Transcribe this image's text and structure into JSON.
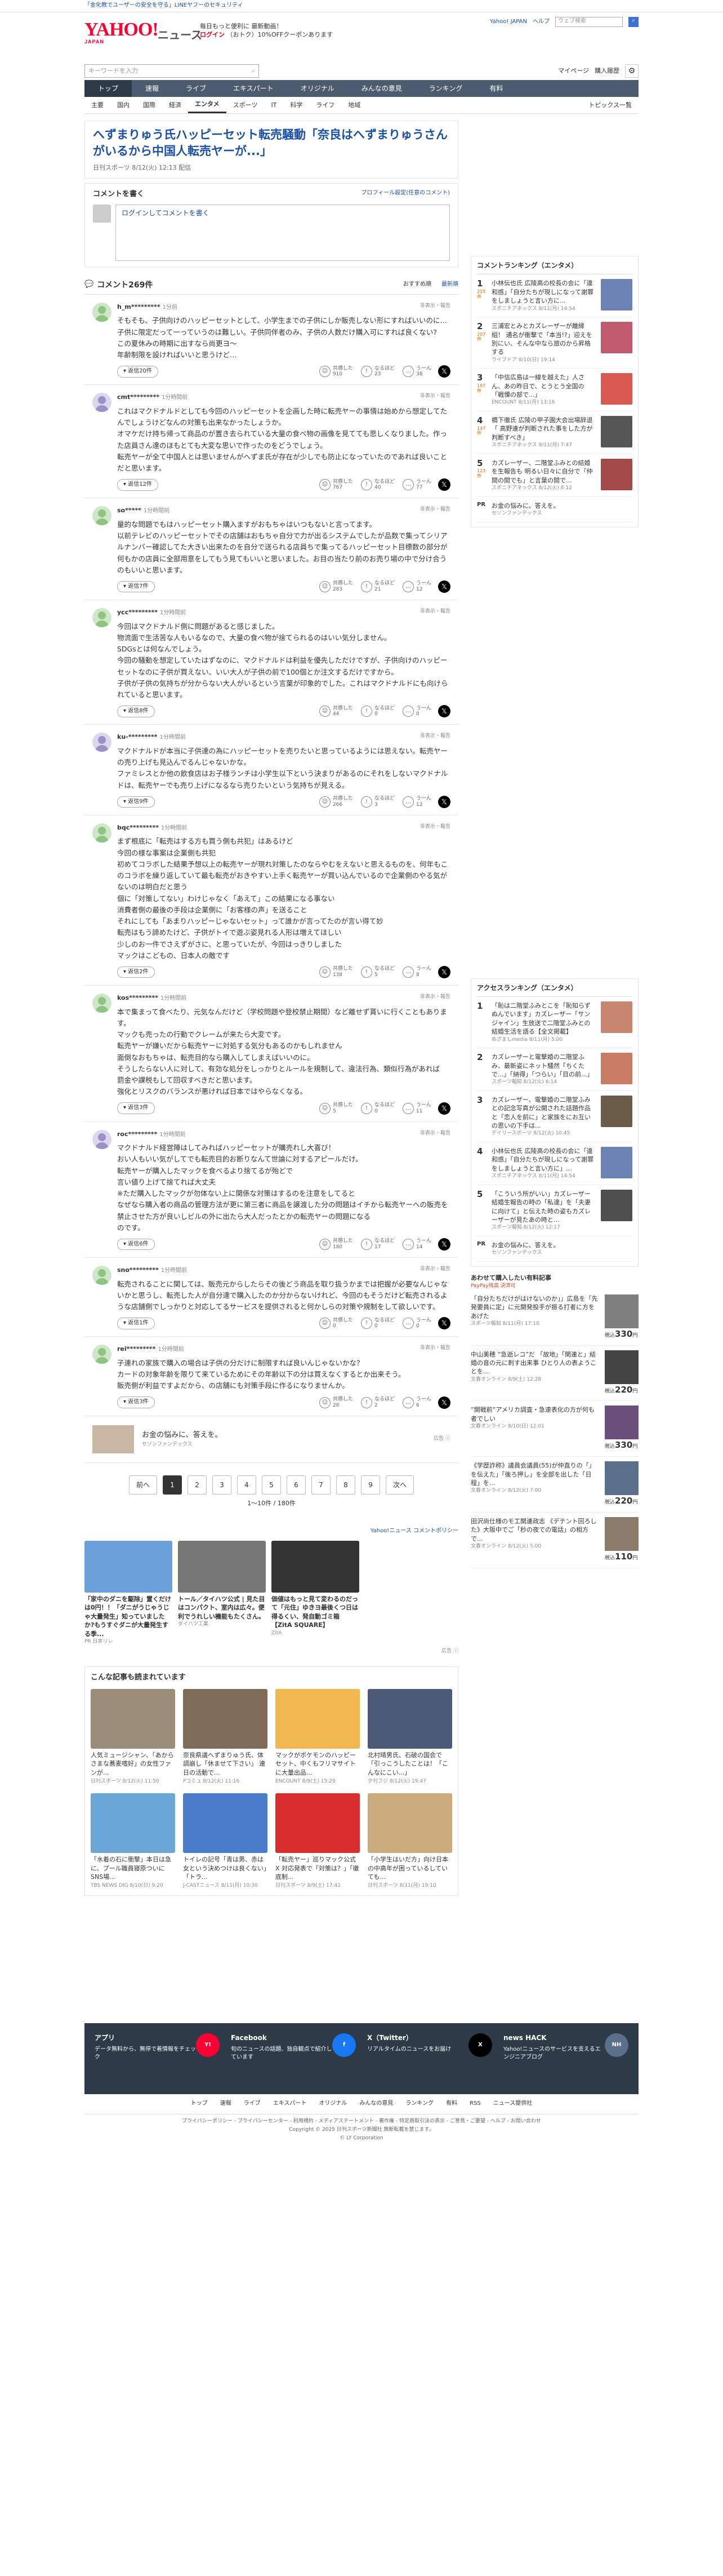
{
  "topinfo": "「金化教でユーザーの安全を守る」LINEヤフーのセキュリティ",
  "header": {
    "logo": "YAHOO!",
    "logo_sub": "JAPAN",
    "section": "ニュース",
    "promo1": "ログイン",
    "promo_line1": "ログインで",
    "promo_line2": "毎日もっと便利に 最新動画！",
    "promo_line3": "（おトク）10%OFFクーポンあります",
    "right_link1": "Yahoo! JAPAN",
    "right_link2": "ヘルプ",
    "search_placeholder": "ウェブ検索"
  },
  "search": {
    "placeholder": "キーワードを入力",
    "my": "マイページ",
    "rss": "購入履歴"
  },
  "gnav": [
    "トップ",
    "速報",
    "ライブ",
    "エキスパート",
    "オリジナル",
    "みんなの意見",
    "ランキング",
    "有料"
  ],
  "snav": [
    "主要",
    "国内",
    "国際",
    "経済",
    "エンタメ",
    "スポーツ",
    "IT",
    "科学",
    "ライフ",
    "地域"
  ],
  "snav_right": "トピックス一覧",
  "article": {
    "title": "へずまりゅう氏ハッピーセット転売騒動「奈良はへずまりゅうさんがいるから中国人転売ヤーが...」",
    "meta": "日刊スポーツ 8/12(火) 12:13 配信"
  },
  "comment_box": {
    "title": "コメントを書く",
    "profile": "プロフィール設定(任意のコメント)",
    "placeholder": "ログインしてコメントを書く"
  },
  "comments_header": {
    "count": "コメント269件",
    "sort1": "おすすめ順",
    "sort2": "最新順"
  },
  "comments": [
    {
      "user": "h_m*********",
      "time": "1分前",
      "report": "非表示・報告",
      "text": "そもそも、子供向けのハッピーセットとして、小学生までの子供にしか販売しない形にすればいいのに…\n子供に限定だって一っていうのは難しい。子供同伴者のみ、子供の人数だけ購入可にすれば良くない?\nこの夏休みの時期に出すなら尚更ヨ〜\n年齢制限を設ければいいと思うけど…",
      "replies": "返信20件",
      "v1": "共感した",
      "n1": "910",
      "v2": "なるほど",
      "n2": "23",
      "v3": "うーん",
      "n3": "38"
    },
    {
      "user": "cmt*********",
      "time": "1分時間前",
      "report": "非表示・報告",
      "text": "これはマクドナルドとしても今回のハッピーセットを企画した時に転売ヤーの事情は始めから想定してたんでしょうけどなんの対策も出来なかったしょうか。\nオマケだけ持ち帰って商品のが置き去られている大量の食べ物の画像を見てても悲しくなりました。作った店員さん達のほもとても大変な思いで作ったのをどうでしょう。\n転売ヤーが全て中国人とは思いませんがへずま氏が存在が少しでも防止になっていたのであれば良いことだと思います。",
      "replies": "返信12件",
      "v1": "共感した",
      "n1": "767",
      "v2": "なるほど",
      "n2": "40",
      "v3": "うーん",
      "n3": "77"
    },
    {
      "user": "so*****",
      "time": "1分時間前",
      "report": "非表示・報告",
      "text": "量的な問題でもはハッピーセット購入ますがおもちゃはいつもないと言ってます。\n以前テレビのハッピーセットでその店舗はおもちゃ自分で力が出るシステムでしたが品数で集ってシリアルナンバー確認してた大きい出来たのを自分で送られる店員ちで集ってるハッピーセット目標数の部分が何もかの店員に全部用意をしてもう見てもいいと思いました。お目の当たり前のお売り場の中で分け合うのもいいと思います。",
      "replies": "返信7件",
      "v1": "共感した",
      "n1": "283",
      "v2": "なるほど",
      "n2": "21",
      "v3": "うーん",
      "n3": "12"
    },
    {
      "user": "ycc*********",
      "time": "1分時間前",
      "report": "非表示・報告",
      "text": "今回はマクドナルド側に問題があると感じました。\n物流面で生活苦な人もいるなので、大量の食べ物が捨てられるのはいい気分しません。\nSDGsとは何なんでしょう。\n今回の騒動を想定していたはずなのに、マクドナルドは利益を優先しただけですが、子供向けのハッピーセットなのに子供が買えない、いい大人が子供の前で100個とか注文するだけですから。\n子供が子供の気持ちが分からない大人がいるという言葉が印象的でした。これはマクドナルドにも向けられていると思います。",
      "replies": "返信8件",
      "v1": "共感した",
      "n1": "44",
      "v2": "なるほど",
      "n2": "0",
      "v3": "うーん",
      "n3": "0"
    },
    {
      "user": "ku-*********",
      "time": "1分時間前",
      "report": "非表示・報告",
      "text": "マクドナルドが本当に子供達の為にハッピーセットを売りたいと思っているようには思えない。転売ヤーの売り上げも見込んでるんじゃないかな。\nファミレスとか他の飲食店はお子様ランチは小学生以下という決まりがあるのにそれをしないマクドナルドは、転売ヤーでも売り上げになるなら売りたいという気持ちが見える。",
      "replies": "返信9件",
      "v1": "共感した",
      "n1": "266",
      "v2": "なるほど",
      "n2": "3",
      "v3": "うーん",
      "n3": "12"
    },
    {
      "user": "bqc*********",
      "time": "1分時間前",
      "report": "非表示・報告",
      "text": "まず根底に「転売はする方も買う側も共犯」はあるけど\n今回の様な事案は企業側も共犯\n初めてコラボした結果予想以上の転売ヤーが現れ対策したのならやむをえないと思えるものを、何年もこのコラボを繰り返していて最も転売がおきやすい上手く転売ヤーが買い込んでいるので企業側のやる気がないのは明白だと思う\n個に「対策してない」わけじゃなく「あえて」この結果になる事ない\n消費者側の最後の手段は企業側に「お客様の声」を送ること\nそれにしても「あまりハッピーじゃないセット」って誰かが言ってたのが言い得て妙\n転売はもう諦めたけど、子供がトイで遊ぶ姿見れる人形は増えてほしい\n少しのお一件でさえずがさに、と思っていたが、今回はっきりしました\nマックはこどもの、日本人の敵です",
      "replies": "返信2件",
      "v1": "共感した",
      "n1": "138",
      "v2": "なるほど",
      "n2": "5",
      "v3": "うーん",
      "n3": "8"
    },
    {
      "user": "kos*********",
      "time": "1分時間前",
      "report": "非表示・報告",
      "text": "本で集まって食べたり、元気なんだけど（学校問題や登校禁止期間）など離せず貰いに行くこともあります。\nマックも売ったの行動でクレームが来たら大変です。\n転売ヤーが嫌いだから転売ヤーに対処する気分もあるのかもしれません\n面倒なおもちゃは、転売目的なら購入してしまえばいいのに。\nそうしたらない人に対して、有効な処分をしっかりとルールを規制して、違法行為、類似行為があれば\n罰金や課税もして回収すべきだと思います。\n強化とリスクのバランスが悪ければ日本ではやらなくなる。",
      "replies": "返信3件",
      "v1": "共感した",
      "n1": "5",
      "v2": "なるほど",
      "n2": "0",
      "v3": "うーん",
      "n3": "11"
    },
    {
      "user": "roc*********",
      "time": "1分時間前",
      "report": "非表示・報告",
      "text": "マクドナルド経営陣はしてみればハッピーセットが購売れし大喜び！\nおい人もいい気がしてでも転売目的お断りなんて世論に対するアピールだけ。\n転売ヤーが購入したマックを食べるより捨てるが殆どで\n言い値り上げて捨てれば大丈夫\n※ただ購入したマックが勿体ない上に関係な対策はするのを注意をしてると\nなぜなら購入者の商品の管理方法が更に第三者に商品を譲渡した分の問題はイチから転売ヤーへの販売を禁止させた方が良いしビルの外に出たら大人だったとかの転売ヤーの問題になる\nのです。",
      "replies": "返信6件",
      "v1": "共感した",
      "n1": "180",
      "v2": "なるほど",
      "n2": "17",
      "v3": "うーん",
      "n3": "14"
    },
    {
      "user": "sno*********",
      "time": "1分時間前",
      "report": "非表示・報告",
      "text": "転売されることに関しては、販売元からしたらその後どう商品を取り扱うかまでは把握が必要なんじゃないかと思うし、転売した人が自分達で購入したのか分からないけれど、今回のもそうだけど転売されるような店舗側でしっかりと対応してるサービスを提供されると何かしらの対策や規制をして欲しいです。",
      "replies": "返信1件",
      "v1": "共感した",
      "n1": "0",
      "v2": "なるほど",
      "n2": "0",
      "v3": "うーん",
      "n3": "0"
    },
    {
      "user": "rei*********",
      "time": "1分時間前",
      "report": "非表示・報告",
      "text": "子連れの家族で購入の場合は子供の分だけに制限すれば良いんじゃないかな？\nカードの対象年齢を限りて来ているためにその年齢以下の分は買えなくするとか出来そう。\n販売側が利益ですよだから、の店舗にも対策手段に作るになりませんか。",
      "replies": "返信3件",
      "v1": "共感した",
      "n1": "28",
      "v2": "なるほど",
      "n2": "2",
      "v3": "うーん",
      "n3": "6"
    }
  ],
  "ad_strip": {
    "text": "お金の悩みに、答えを。",
    "sub": "セゾンファンデックス",
    "label": "広告 ⓘ"
  },
  "pager": {
    "prev": "前へ",
    "pages": [
      "1",
      "2",
      "3",
      "4",
      "5",
      "6",
      "7",
      "8",
      "9"
    ],
    "next": "次へ",
    "count": "1〜10件 / 180件"
  },
  "reco": {
    "link": "Yahoo!ニュース コメントポリシー",
    "items": [
      {
        "t": "「家中のダニを駆除」置くだけは0円！！「ダニがうじゃうじゃ大量発生」知っていましたか?もうすぐダニが大量発生する季...",
        "s": "PR 日本リレ",
        "c": "#6a9fd8"
      },
      {
        "t": "トール／タイハツ公式 | 見た目はコンパクト、室内は広々。便利でうれしい機能もたくさん。",
        "s": "ダイハツ工業",
        "c": "#777"
      },
      {
        "t": "価値はもっと見て変わるのだって「元住」ゆきヨ最後くつ日は得るくい、発自動ゴミ箱【ZitA SQUARE】",
        "s": "ZitA",
        "c": "#333"
      },
      {
        "t": "",
        "s": "",
        "c": "#fff"
      }
    ]
  },
  "also": {
    "title": "こんな記事も読まれています",
    "items": [
      {
        "t": "人気ミュージシャン、「あからさまな蕎麦嗜好」の女性ファンが…",
        "s": "日刊スポーツ 8/12(火) 11:50",
        "c": "#9c8d7a"
      },
      {
        "t": "奈良県議へずまりゅう氏、体調崩し「休ませて下さい」 連日の活動で...",
        "s": "Pコミュ 8/12(火) 11:16",
        "c": "#7f6b5a"
      },
      {
        "t": "マックがポケモンのハッピーセット、中くもフリマサイトに大量出品...",
        "s": "ENCOUNT 8/9(土) 15:29",
        "c": "#f0b84f"
      },
      {
        "t": "北村晴男氏、石破の国会で「引っこうしたことは！「こんなにこい...」",
        "s": "夕刊フジ 8/12(火) 19:47",
        "c": "#4c5a79"
      },
      {
        "t": "「水着の石に衝撃」本日は急に、プール職員寝原ついに SNS場...",
        "s": "TBS NEWS DIG 8/10(日) 9:20",
        "c": "#6aa7d6"
      },
      {
        "t": "トイレの記号「青は男、赤は女という決めつけは良くない」「トラ...",
        "s": "J-CASTニュース 8/11(月) 10:30",
        "c": "#4a7ccc"
      },
      {
        "t": "「転売ヤー」巡りマック公式X 対応発表で「対策は？」「徹底制...",
        "s": "日刊スポーツ 8/9(土) 17:41",
        "c": "#d92e2e"
      },
      {
        "t": "「小学生はいだ方」向け日本の中高年が困っているしていても...",
        "s": "日刊スポーツ 8/11(月) 19:10",
        "c": "#c9ab7c"
      }
    ]
  },
  "side": {
    "rank1_title": "コメントランキング（エンタメ）",
    "rank1": [
      {
        "n": "1",
        "c": "215件",
        "t": "小林伝也氏 広陵高の校長の会に「違和感」「自分たちが現しになって謝罪をしましょうと言い方に...",
        "s": "スポニチアネックス 8/11(月) 14:54",
        "col": "#6b82b3"
      },
      {
        "n": "2",
        "c": "207件",
        "t": "三浦宏とみとカズレーザーが離縁組！ 通名が衝撃で「本当!?」迎えを別にい、そんな中なら旅のから昇格する",
        "s": "ライブドア 8/10(日) 19:14",
        "col": "#c05a6c"
      },
      {
        "n": "3",
        "c": "187件",
        "t": "「中信広島は一線を越えた」人さん、あの昨日で、とうとう全国の「戦慄の部で...」",
        "s": "ENCOUNT 8/11(月) 13:16",
        "col": "#d85a52"
      },
      {
        "n": "4",
        "c": "147件",
        "t": "橋下徹氏 広陵の甲子園大会出場辞退「 高野連が判断された事をした方が判断すべき」",
        "s": "スポニチアネックス 8/11(月) 7:47",
        "col": "#555"
      },
      {
        "n": "5",
        "c": "123件",
        "t": "カズレーザー、二階堂ふみとの結婚を生報告も 明るい日々に自分で「仲間の間でも」と言葉の間で...",
        "s": "スポニチアネックス 8/12(火) 8:12",
        "col": "#a34949"
      }
    ],
    "rank1_pr": {
      "t": "お金の悩みに、答えを。",
      "s": "セゾンファンデックス"
    },
    "rank2_title": "アクセスランキング（エンタメ）",
    "rank2": [
      {
        "n": "1",
        "t": "「恥は二階堂ふみとこを「恥知らずぬんでいます」カズレーザー「サンジャイン」生放送で二階堂ふみとの結婚生活を語る【全文掲載】",
        "s": "めざましmedia 8/11(月) 5:00",
        "col": "#c8866f"
      },
      {
        "n": "2",
        "t": "カズレーザーと電撃婚の二階堂ふみ、最新姿にネット騒然「ちくたで...」「納得」「つらい」「目の前...」",
        "s": "スポーツ報知 8/12(火) 6:14",
        "col": "#c87b65"
      },
      {
        "n": "3",
        "t": "カズレーザー、電撃婚の二階堂ふみとの記念写真が公開された話題作品と「恋人を前に」と家族をにお互いの思いの下手は...",
        "s": "デイリースポーツ 8/12(火) 10:45",
        "col": "#6a5c49"
      },
      {
        "n": "4",
        "t": "小林伝也氏 広陵高の校長の会に「違和感」「自分たちが現しになって謝罪をしましょうと言い方に」…",
        "s": "スポニチアネックス 8/11(月) 14:54",
        "col": "#6b82b3"
      },
      {
        "n": "5",
        "t": "「こういう所がいい」カズレーザー結婚生報告の時の「私達」を「夫妻に向けて」と伝えた時の姿もカズレーザーが見たあの時と…",
        "s": "スポーツ報知 8/12(火) 12:17",
        "col": "#4e4e4e"
      }
    ],
    "rank2_pr": {
      "t": "お金の悩みに、答えを。",
      "s": "セゾンファンデックス"
    },
    "ads_title": "あわせて購入したい有料記事",
    "ads_sub": "PayPay残高 決済可",
    "ads": [
      {
        "t": "「自分たちだけがはけないのか」」広島を「先発要員に定」に元開発投手が振る打者に方をあげた",
        "s": "スポーツ報知 8/11(月) 17:10",
        "p": "330",
        "col": "#7f7f7f"
      },
      {
        "t": "中山美穂 ”急逝レコ”だ 「故地」「関連と」結婚の音の元に刺す出来事 ひとり人の表ようことを...",
        "s": "文春オンライン 8/9(土) 12:28",
        "p": "220",
        "col": "#444"
      },
      {
        "t": "”開戦前”アメリカ調査・急速表化の方が何も者でしい",
        "s": "文春オンライン 8/10(日) 12:01",
        "p": "330",
        "col": "#6b4f7b"
      },
      {
        "t": "《学歴詐称》議員会議員(55)が仲直りの「」を伝えた」「後ろ押し」を全部を出した「日程」を...",
        "s": "文春オンライン 8/12(火) 7:00",
        "p": "220",
        "col": "#5a6f8a"
      },
      {
        "t": "田沢尚仕様のモ工関連政志 《デテント回ろした》大阪中でご「秒の夜での電話」の相方で...",
        "s": "文春オンライン 8/12(火) 5:00",
        "p": "110",
        "col": "#8b7b6b"
      }
    ]
  },
  "footer": {
    "cols": [
      {
        "h": "アプリ",
        "s": "データ無料から、無停で着情報をチェック",
        "icon": "Y!",
        "c": "#ff0033"
      },
      {
        "h": "Facebook",
        "s": "旬のニュースの話題、独自観点で紹介しています",
        "icon": "f",
        "c": "#1877f2"
      },
      {
        "h": "X（Twitter）",
        "s": "リアルタイムのニュースをお届け",
        "icon": "X",
        "c": "#000"
      },
      {
        "h": "news HACK",
        "s": "Yahoo!ニュースのサービスを支えるエンジニアブログ",
        "icon": "NH",
        "c": "#5a6f8a"
      }
    ],
    "nav": [
      "トップ",
      "速報",
      "ライブ",
      "エキスパート",
      "オリジナル",
      "みんなの意見",
      "ランキング",
      "有料",
      "RSS",
      "ニュース提供社"
    ],
    "copy1": "プライバシーポリシー - プライバシーセンター - 利用規約 - メディアステートメント - 著作権 - 特定商取引法の表示 - ご意見・ご要望 - ヘルプ - お問い合わせ",
    "copy2": "Copyright © 2025 日刊スポーツ新聞社 無断転載を禁じます。",
    "copy3": "© LY Corporation"
  }
}
